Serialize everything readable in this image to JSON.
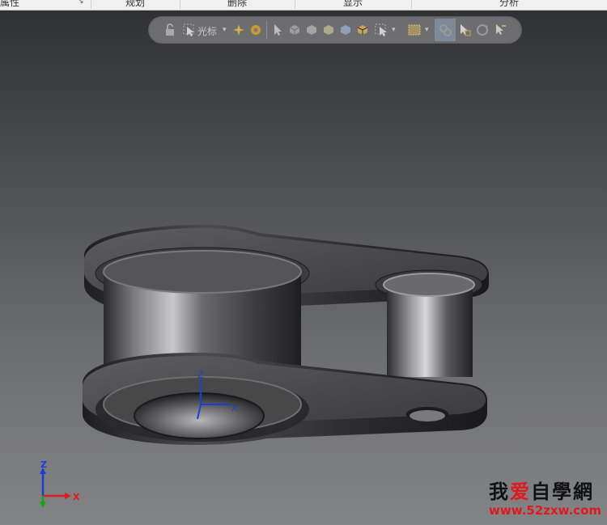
{
  "ribbon": {
    "groups": [
      "属性",
      "规划",
      "删除",
      "显示",
      "分析"
    ]
  },
  "toolbar": {
    "selection_mode_label": "光标"
  },
  "viewport": {
    "triad_labels": {
      "z": "Z",
      "x": "X"
    },
    "corner_triad_labels": {
      "z": "Z",
      "x": "X"
    }
  },
  "watermark": {
    "chars_before": "我",
    "heart_char": "爱",
    "chars_after": "自學網",
    "url": "www.52zxw.com"
  },
  "colors": {
    "background_top": "#2e2f31",
    "background_bottom": "#838486",
    "axis_x": "#e01b1b",
    "axis_y": "#16a316",
    "axis_z": "#1a3fd6",
    "watermark_red": "#e0191f"
  }
}
